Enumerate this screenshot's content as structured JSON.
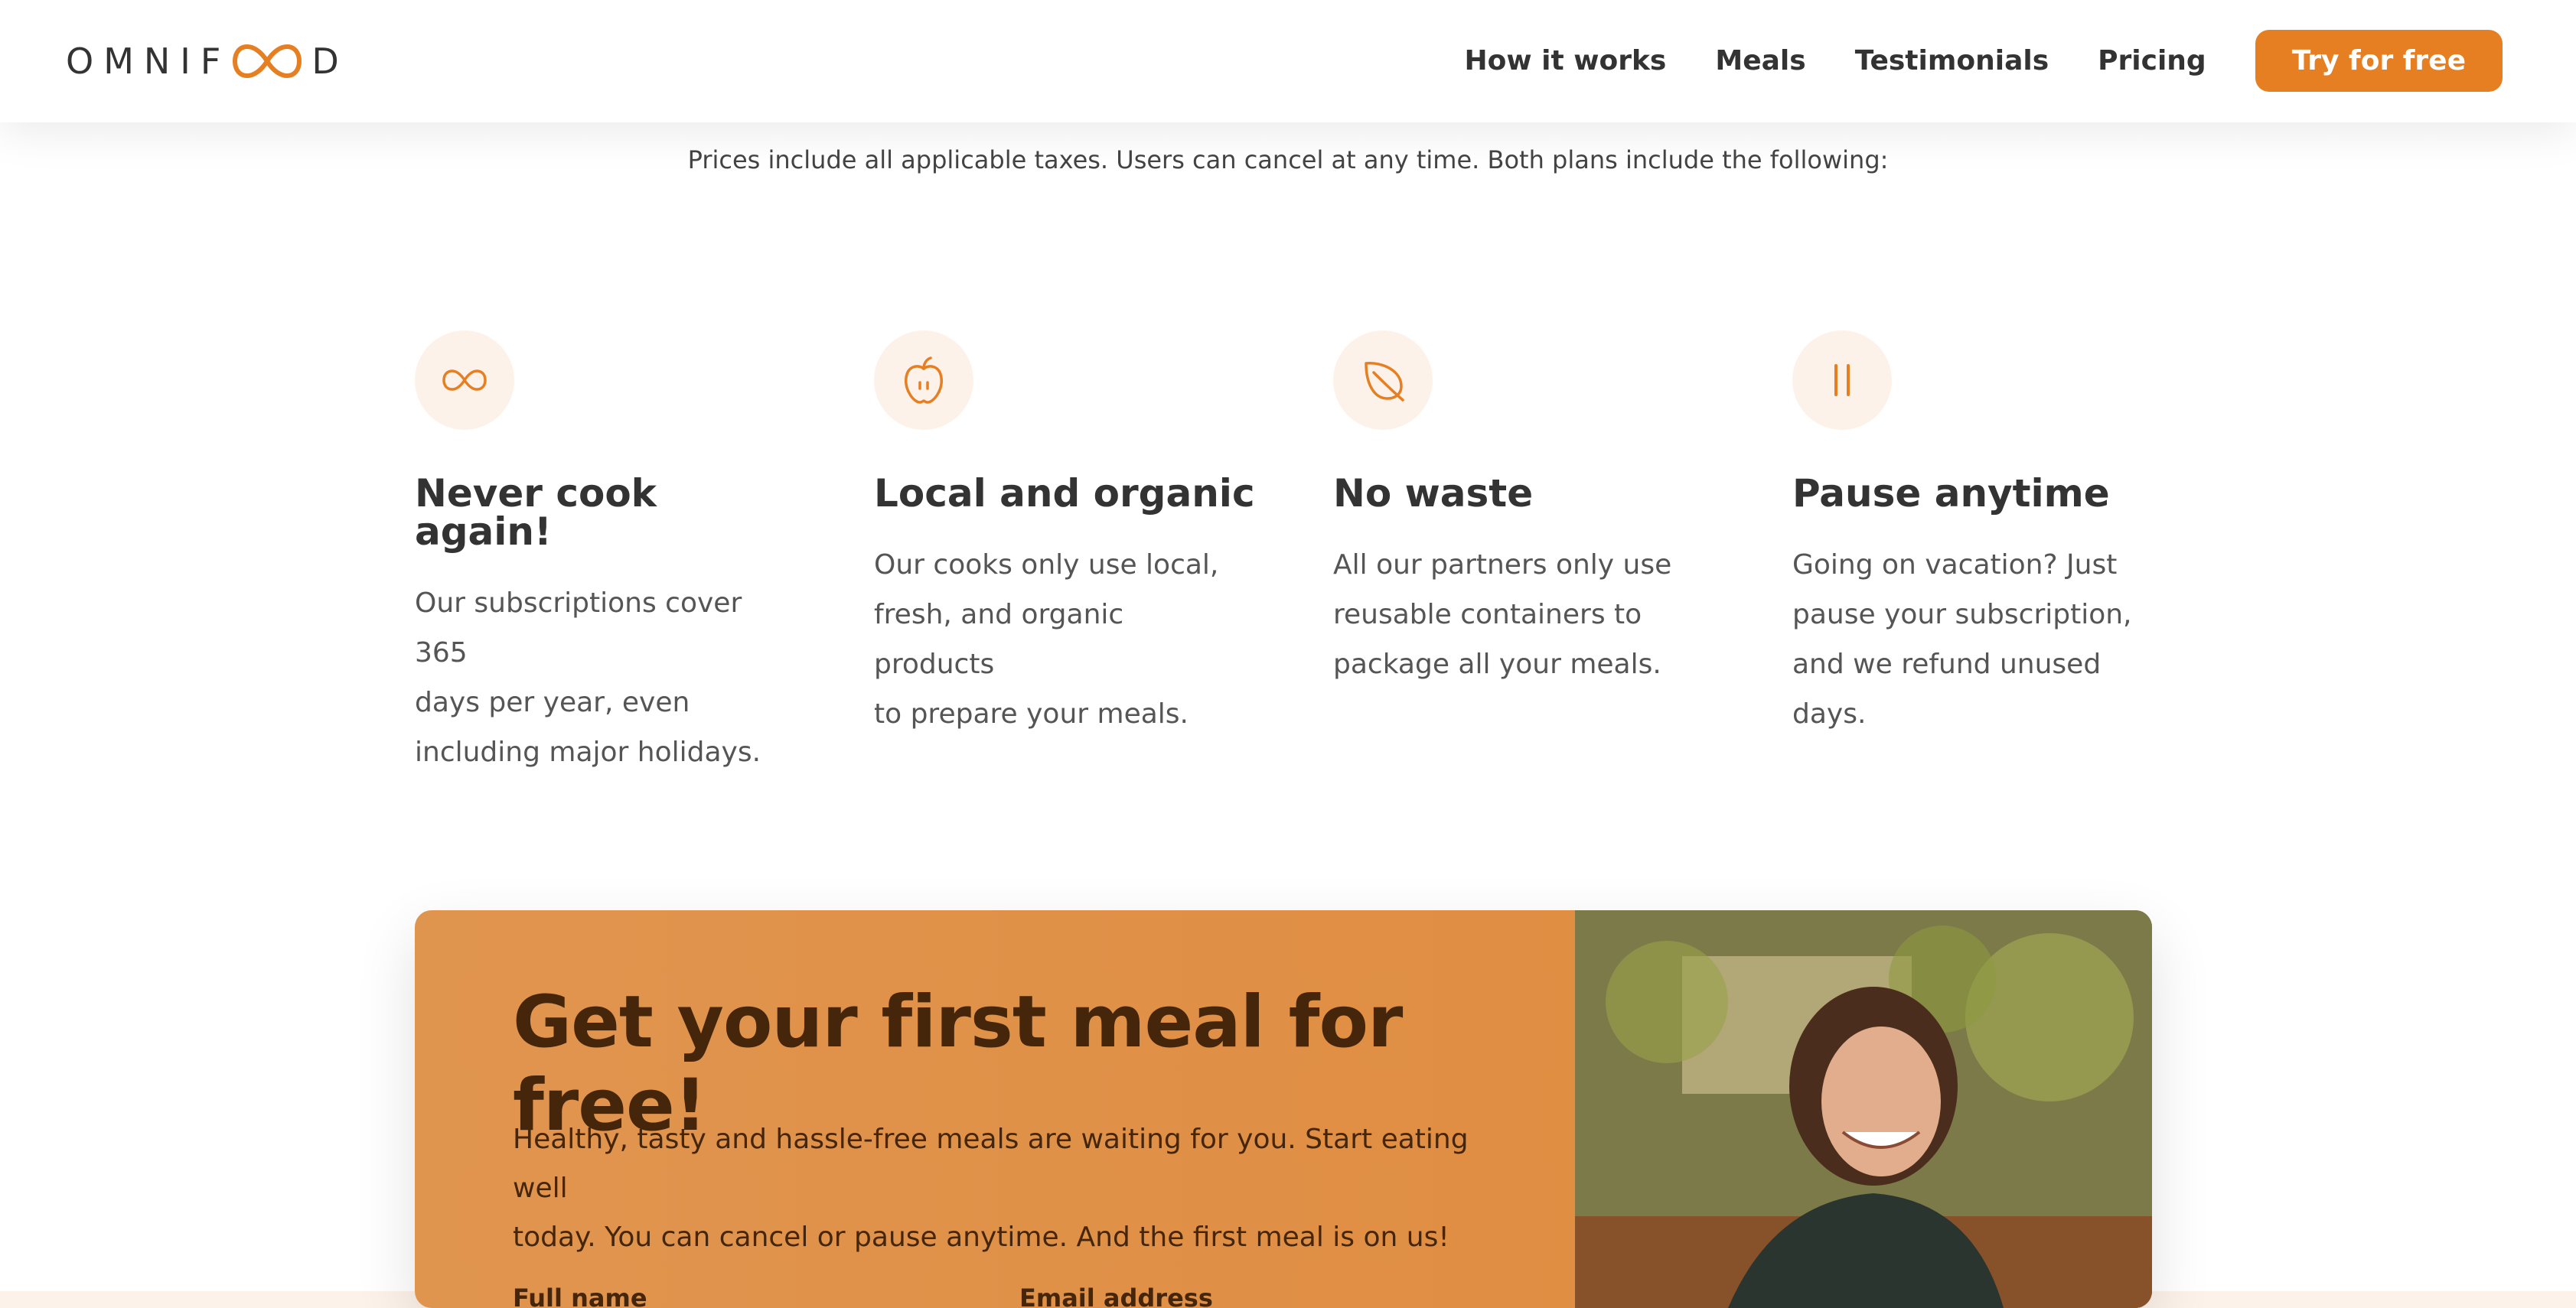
{
  "header": {
    "logo_text_left": "OMNIF",
    "logo_text_right": "D",
    "nav": [
      "How it works",
      "Meals",
      "Testimonials",
      "Pricing"
    ],
    "cta_label": "Try for free"
  },
  "pricing_note": "Prices include all applicable taxes. Users can cancel at any time. Both plans include the following:",
  "features": [
    {
      "icon": "infinity-icon",
      "title": "Never cook again!",
      "desc_lines": [
        "Our subscriptions cover 365",
        "days per year, even",
        "including major holidays."
      ]
    },
    {
      "icon": "apple-icon",
      "title": "Local and organic",
      "desc_lines": [
        "Our cooks only use local,",
        "fresh, and organic products",
        "to prepare your meals."
      ]
    },
    {
      "icon": "leaf-icon",
      "title": "No waste",
      "desc_lines": [
        "All our partners only use",
        "reusable containers to",
        "package all your meals."
      ]
    },
    {
      "icon": "pause-icon",
      "title": "Pause anytime",
      "desc_lines": [
        "Going on vacation? Just",
        "pause your subscription,",
        "and we refund unused days."
      ]
    }
  ],
  "cta": {
    "title": "Get your first meal for free!",
    "desc_lines": [
      "Healthy, tasty and hassle-free meals are waiting for you. Start eating well",
      "today. You can cancel or pause anytime. And the first meal is on us!"
    ],
    "field_label_1": "Full name",
    "field_label_2": "Email address",
    "photo": "woman-smiling-photo"
  },
  "colors": {
    "accent": "#e67e22",
    "accent_light": "#fdf2e9",
    "text_dark": "#333333",
    "cta_text": "#45260a"
  }
}
